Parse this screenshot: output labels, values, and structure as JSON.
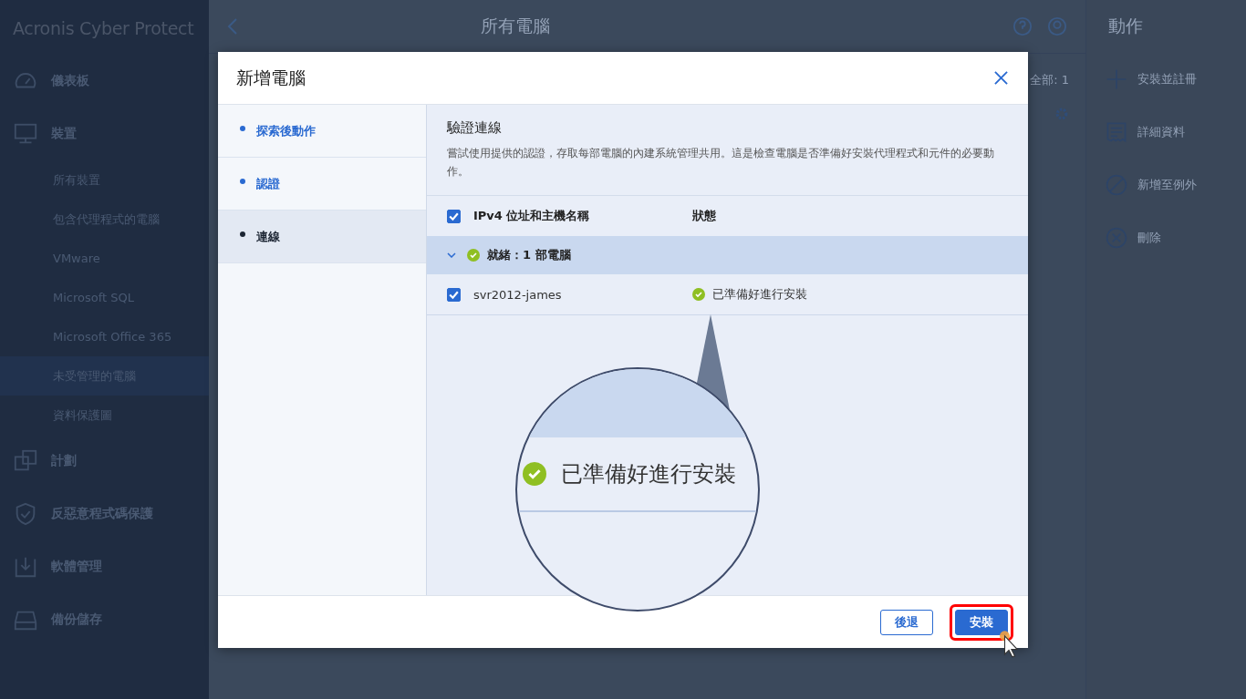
{
  "app": {
    "brand": "Acronis Cyber Protect",
    "nav": [
      {
        "label": "儀表板",
        "kind": "main"
      },
      {
        "label": "裝置",
        "kind": "main"
      },
      {
        "label": "所有裝置",
        "kind": "sub",
        "selected": false
      },
      {
        "label": "包含代理程式的電腦",
        "kind": "sub",
        "selected": false
      },
      {
        "label": "VMware",
        "kind": "sub",
        "selected": false
      },
      {
        "label": "Microsoft SQL",
        "kind": "sub",
        "selected": false
      },
      {
        "label": "Microsoft Office 365",
        "kind": "sub",
        "selected": false
      },
      {
        "label": "未受管理的電腦",
        "kind": "sub",
        "selected": true
      },
      {
        "label": "資料保護圖",
        "kind": "sub",
        "selected": false
      },
      {
        "label": "計劃",
        "kind": "main"
      },
      {
        "label": "反惡意程式碼保護",
        "kind": "main"
      },
      {
        "label": "軟體管理",
        "kind": "main"
      },
      {
        "label": "備份儲存",
        "kind": "main"
      }
    ],
    "header": {
      "title": "所有電腦",
      "count": "全部: 1"
    },
    "actions": {
      "title": "動作",
      "items": [
        {
          "label": "安裝並註冊"
        },
        {
          "label": "詳細資料"
        },
        {
          "label": "新增至例外"
        },
        {
          "label": "刪除"
        }
      ]
    }
  },
  "dialog": {
    "title": "新增電腦",
    "steps": [
      {
        "label": "探索後動作",
        "selected": false
      },
      {
        "label": "認證",
        "selected": false
      },
      {
        "label": "連線",
        "selected": true
      }
    ],
    "section_title": "驗證連線",
    "description": "嘗試使用提供的認證，存取每部電腦的內建系統管理共用。這是檢查電腦是否準備好安裝代理程式和元件的必要動作。",
    "table": {
      "select_all": true,
      "columns": [
        "IPv4 位址和主機名稱",
        "狀態"
      ],
      "group": {
        "label": "就緒：1 部電腦",
        "expanded": true
      },
      "rows": [
        {
          "host": "svr2012-james",
          "status": "已準備好進行安裝",
          "checked": true
        }
      ]
    },
    "magnifier": {
      "status": "已準備好進行安裝"
    },
    "buttons": [
      {
        "label": "後退",
        "kind": "secondary",
        "highlighted": false
      },
      {
        "label": "安裝",
        "kind": "primary",
        "highlighted": true
      }
    ]
  }
}
